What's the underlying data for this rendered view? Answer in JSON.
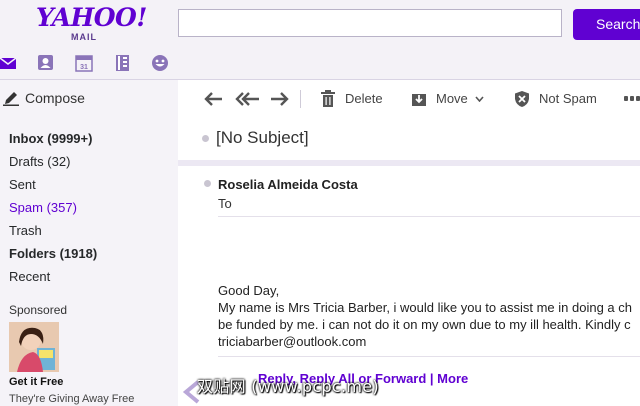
{
  "header": {
    "logo_word": "YAHOO!",
    "logo_sub": "MAIL",
    "search_value": "",
    "search_button": "Search",
    "app_icons": [
      "mail-icon",
      "contacts-icon",
      "calendar-icon",
      "notepad-icon",
      "messenger-icon"
    ],
    "calendar_day": "31"
  },
  "colors": {
    "brand": "#6001d2",
    "sidebar_bg": "#f5f3f8",
    "topbar_bg": "#f4f2f7"
  },
  "sidebar": {
    "compose": "Compose",
    "folders": [
      {
        "label": "Inbox (9999+)"
      },
      {
        "label": "Drafts (32)"
      },
      {
        "label": "Sent"
      },
      {
        "label": "Spam (357)"
      },
      {
        "label": "Trash"
      },
      {
        "label": "Folders (1918)"
      },
      {
        "label": "Recent"
      }
    ],
    "sponsored": "Sponsored",
    "ad_title": "Get it Free",
    "ad_text": "They're Giving Away Free"
  },
  "toolbar": {
    "delete": "Delete",
    "move": "Move",
    "not_spam": "Not Spam"
  },
  "message": {
    "subject": "[No Subject]",
    "sender": "Roselia Almeida Costa",
    "to": "To",
    "body": [
      "Good Day,",
      "My name is Mrs Tricia Barber, i would like you to assist me in doing a ch",
      "be funded by me. i can not do it on my own due to my ill health. Kindly c",
      "triciabarber@outlook.com"
    ],
    "reply_links": "Reply, Reply All or Forward | More"
  },
  "watermark": "双贴网 (www.pcpc.me)"
}
